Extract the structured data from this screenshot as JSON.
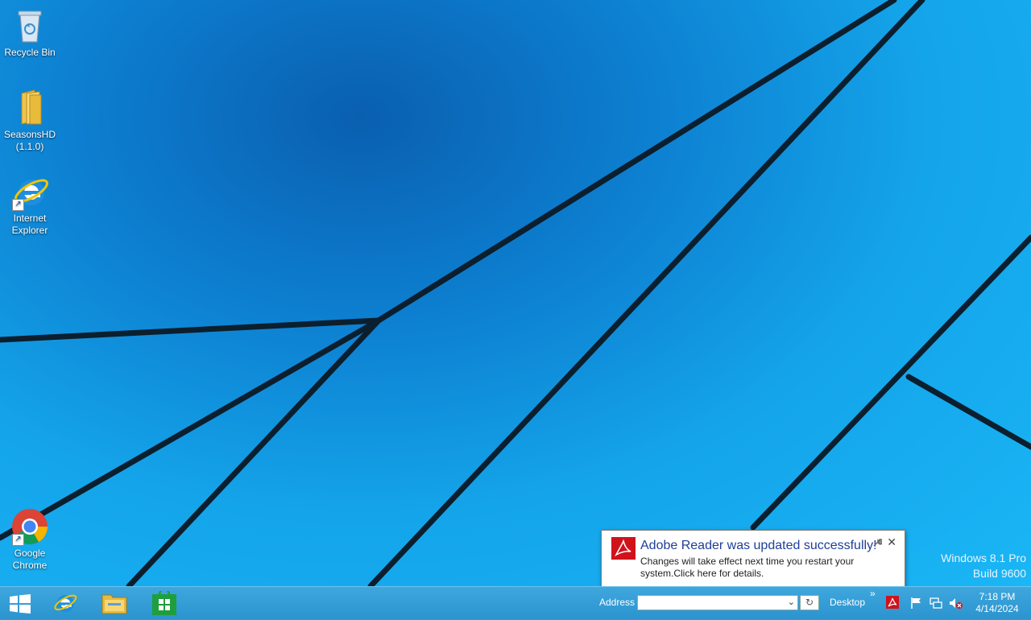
{
  "desktop": {
    "icons": [
      {
        "label": "Recycle Bin"
      },
      {
        "label": "SeasonsHD\n(1.1.0)"
      },
      {
        "label": "Internet\nExplorer"
      },
      {
        "label": "Google\nChrome"
      }
    ]
  },
  "watermark": {
    "line1": "Windows 8.1 Pro",
    "line2": "Build 9600"
  },
  "notification": {
    "title": "Adobe Reader was updated successfully!",
    "body": "Changes will take effect next time you restart your system.Click here for details.",
    "options_icon": "wrench-icon",
    "close_label": "✕"
  },
  "taskbar": {
    "pinned": [
      {
        "name": "start",
        "icon": "windows-logo-icon"
      },
      {
        "name": "internet-explorer",
        "icon": "ie-icon"
      },
      {
        "name": "file-explorer",
        "icon": "folder-icon"
      },
      {
        "name": "store",
        "icon": "store-icon"
      }
    ],
    "address_label": "Address",
    "address_value": "",
    "desktop_label": "Desktop",
    "chevron": "»",
    "refresh_glyph": "↻",
    "dropdown_glyph": "⌄"
  },
  "tray": {
    "icons": [
      "adobe-reader-icon",
      "action-center-flag-icon",
      "network-icon",
      "volume-muted-icon"
    ]
  },
  "clock": {
    "time": "7:18 PM",
    "date": "4/14/2024"
  },
  "colors": {
    "accent": "#2b94cf",
    "notification_title": "#1f3f99",
    "adobe_red": "#d0121b"
  }
}
